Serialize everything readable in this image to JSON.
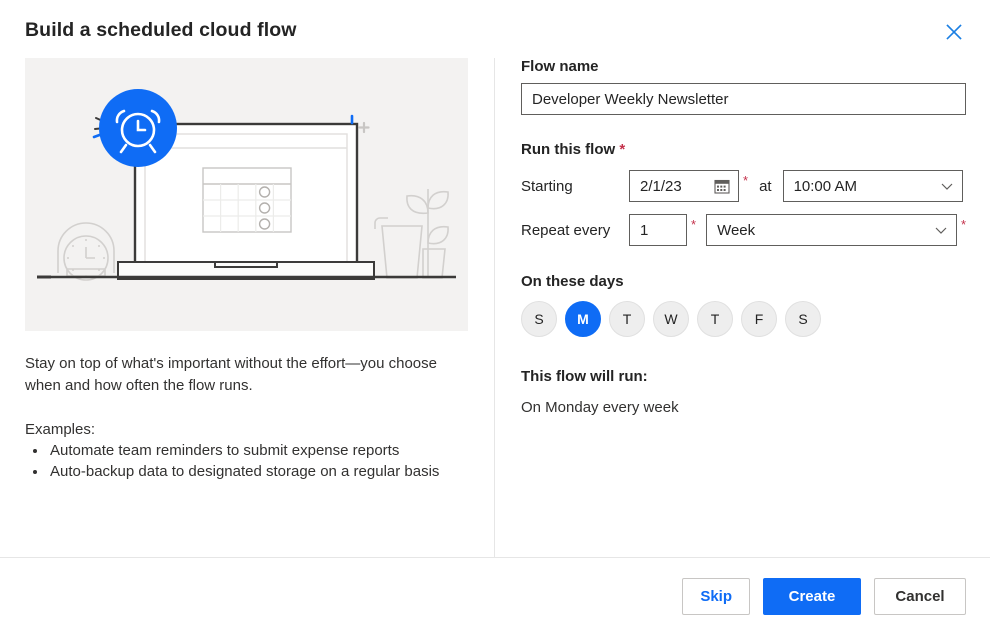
{
  "dialog": {
    "title": "Build a scheduled cloud flow",
    "close_icon": "close-icon"
  },
  "illustration": {
    "alt": "Laptop on a desk showing a calendar, with an alarm clock badge, a mantel clock and a potted plant",
    "badge_icon": "alarm-clock-icon"
  },
  "left_panel": {
    "description": "Stay on top of what's important without the effort—you choose when and how often the flow runs.",
    "examples_label": "Examples:",
    "examples": [
      "Automate team reminders to submit expense reports",
      "Auto-backup data to designated storage on a regular basis"
    ]
  },
  "form": {
    "flow_name": {
      "label": "Flow name",
      "value": "Developer Weekly Newsletter",
      "placeholder": "Flow name"
    },
    "run_section": {
      "label": "Run this flow",
      "required_marker": "*"
    },
    "starting": {
      "label": "Starting",
      "date_value": "2/1/23",
      "date_icon": "calendar-icon",
      "required_marker": "*",
      "at_label": "at",
      "time_value": "10:00 AM",
      "time_icon": "chevron-down-icon"
    },
    "repeat": {
      "label": "Repeat every",
      "interval_value": "1",
      "interval_required_marker": "*",
      "frequency_value": "Week",
      "frequency_icon": "chevron-down-icon",
      "frequency_required_marker": "*"
    },
    "days": {
      "label": "On these days",
      "items": [
        {
          "letter": "S",
          "name": "Sunday",
          "selected": false
        },
        {
          "letter": "M",
          "name": "Monday",
          "selected": true
        },
        {
          "letter": "T",
          "name": "Tuesday",
          "selected": false
        },
        {
          "letter": "W",
          "name": "Wednesday",
          "selected": false
        },
        {
          "letter": "T",
          "name": "Thursday",
          "selected": false
        },
        {
          "letter": "F",
          "name": "Friday",
          "selected": false
        },
        {
          "letter": "S",
          "name": "Saturday",
          "selected": false
        }
      ]
    },
    "summary": {
      "label": "This flow will run:",
      "text": "On Monday every week"
    }
  },
  "footer": {
    "skip_label": "Skip",
    "create_label": "Create",
    "cancel_label": "Cancel"
  },
  "colors": {
    "accent": "#0f6cf5",
    "required": "#c4314b",
    "text": "#242424",
    "border": "#605e5c",
    "illustration_bg": "#f3f2f1"
  }
}
